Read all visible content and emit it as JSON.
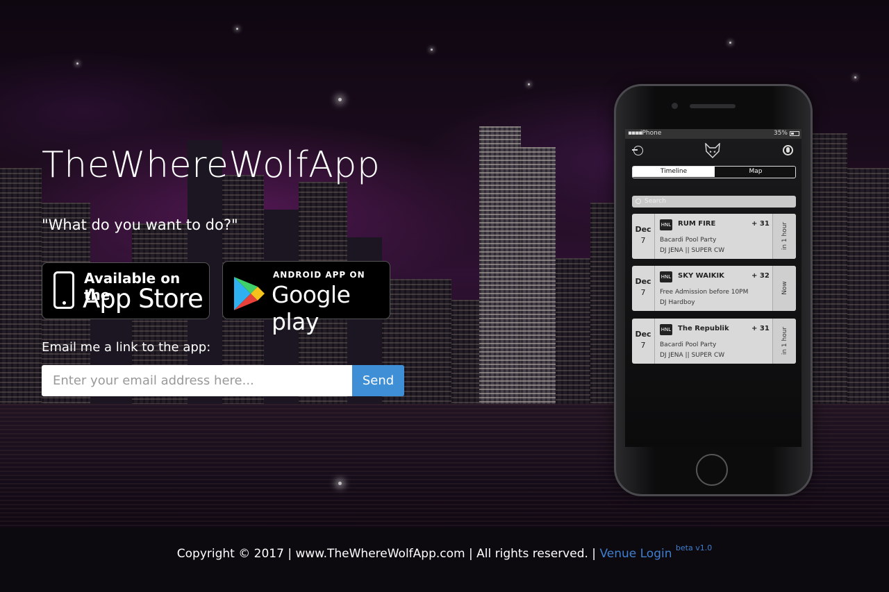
{
  "brand": {
    "title": "TheWhereWolfApp"
  },
  "hero": {
    "tagline": "\"What do you want to do?\"",
    "appstore": {
      "line1": "Available on the",
      "line2": "App Store"
    },
    "googleplay": {
      "line1": "ANDROID APP ON",
      "line2": "Google play"
    },
    "email_label": "Email me a link to the app:",
    "email_placeholder": "Enter your email address here...",
    "send_label": "Send"
  },
  "phone": {
    "status": {
      "carrier": "iPhone",
      "battery": "35%"
    },
    "tabs": [
      {
        "label": "Timeline",
        "active": true
      },
      {
        "label": "Map",
        "active": false
      }
    ],
    "search_placeholder": "Search",
    "events": [
      {
        "month": "Dec",
        "day": "7",
        "venue": "RUM FIRE",
        "count": "+ 31",
        "line1": "Bacardi Pool Party",
        "line2": "DJ JENA || SUPER CW",
        "when": "in 1 hour",
        "logo": "HNL"
      },
      {
        "month": "Dec",
        "day": "7",
        "venue": "SKY WAIKIK",
        "count": "+ 32",
        "line1": "Free Admission before 10PM",
        "line2": "DJ Hardboy",
        "when": "Now",
        "logo": "HNL"
      },
      {
        "month": "Dec",
        "day": "7",
        "venue": "The Republik",
        "count": "+ 31",
        "line1": "Bacardi Pool Party",
        "line2": "DJ JENA || SUPER CW",
        "when": "in 1 hour",
        "logo": "HNL"
      }
    ]
  },
  "footer": {
    "copyright": "Copyright © 2017 | www.TheWhereWolfApp.com | All rights reserved. |",
    "venue_login": "Venue Login",
    "beta": "beta v1.0"
  },
  "colors": {
    "accent": "#3f8fd6",
    "link": "#3f7fd0",
    "footer_bg": "#0d0a0f"
  }
}
